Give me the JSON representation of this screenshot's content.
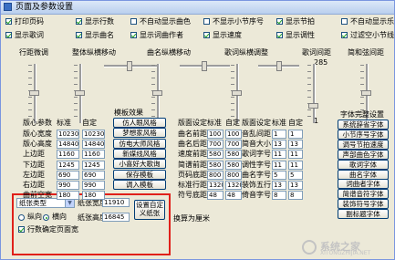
{
  "window": {
    "title": "页面及参数设置"
  },
  "checkboxes": [
    {
      "label": "打印页码",
      "checked": true
    },
    {
      "label": "显示行数",
      "checked": true
    },
    {
      "label": "不自动显示曲色",
      "checked": false
    },
    {
      "label": "不显示小节序号",
      "checked": false
    },
    {
      "label": "显示节拍",
      "checked": true
    },
    {
      "label": "不自动显示乐",
      "checked": false
    },
    {
      "label": "显示歌词",
      "checked": true
    },
    {
      "label": "显示曲名",
      "checked": true
    },
    {
      "label": "显示词曲作者",
      "checked": true
    },
    {
      "label": "显示速度",
      "checked": true
    },
    {
      "label": "显示调性",
      "checked": true
    },
    {
      "label": "过滤空小节线",
      "checked": true
    }
  ],
  "sliders": {
    "line_spacing": {
      "label": "行距微调"
    },
    "global_vertical": {
      "label": "整体纵横移动"
    },
    "title_vertical": {
      "label": "曲名纵横移动"
    },
    "lyrics_vertical": {
      "label": "歌词纵横调整"
    },
    "lyrics_spacing": {
      "label": "歌词间距",
      "value": "285",
      "min": "1"
    },
    "simple_spacing": {
      "label": "简和弦间距"
    }
  },
  "margins": {
    "headers": [
      "版心参数",
      "标准",
      "自定"
    ],
    "rows": [
      {
        "label": "版心宽度",
        "std": "10230",
        "custom": "10230"
      },
      {
        "label": "版心高度",
        "std": "14840",
        "custom": "14840"
      },
      {
        "label": "上边距",
        "std": "1160",
        "custom": "1160"
      },
      {
        "label": "下边距",
        "std": "1245",
        "custom": "1245"
      },
      {
        "label": "左边距",
        "std": "690",
        "custom": "690"
      },
      {
        "label": "右边距",
        "std": "990",
        "custom": "990"
      },
      {
        "label": "曲前空宽",
        "std": "180",
        "custom": "180"
      }
    ]
  },
  "style_buttons": {
    "header": "模板效果",
    "items": [
      "仿人眼风格",
      "梦想家风格",
      "仿电大师风格",
      "新媒线风格",
      "小喜好大歌询",
      "保存模板",
      "调入模板"
    ]
  },
  "spacing": {
    "headers": [
      "版面设定",
      "标准",
      "自定"
    ],
    "rows": [
      {
        "label": "曲名前距",
        "std": "100",
        "custom": "100"
      },
      {
        "label": "曲名后距",
        "std": "700",
        "custom": "700"
      },
      {
        "label": "速度前距",
        "std": "580",
        "custom": "580"
      },
      {
        "label": "简谱前距",
        "std": "580",
        "custom": "580"
      },
      {
        "label": "页码底距",
        "std": "800",
        "custom": "800"
      },
      {
        "label": "标准行距",
        "std": "1320",
        "custom": "1320"
      },
      {
        "label": "符号底距",
        "std": "48",
        "custom": "48"
      }
    ]
  },
  "fonts": {
    "headers": [
      "版面设定",
      "标准",
      "自定"
    ],
    "rows": [
      {
        "label": "音乱间距",
        "std": "1",
        "custom": "1"
      },
      {
        "label": "简音大小",
        "std": "13",
        "custom": "13"
      },
      {
        "label": "歌词字号",
        "std": "11",
        "custom": "11"
      },
      {
        "label": "调性字号",
        "std": "11",
        "custom": "11"
      },
      {
        "label": "曲名字号",
        "std": "5",
        "custom": "5"
      },
      {
        "label": "装饰五行",
        "std": "13",
        "custom": "13"
      },
      {
        "label": "倚音字号",
        "std": "8",
        "custom": "8"
      }
    ]
  },
  "font_settings": {
    "header": "字体完整设置",
    "items": [
      "系统辞省字体",
      "小节序号字体",
      "调号节拍速度",
      "声部曲色字体",
      "歌词字体",
      "曲名字体",
      "词曲者字体",
      "简谱音符字体",
      "装饰符号字体",
      "副标题字体"
    ]
  },
  "paper": {
    "type": "纸张类型",
    "width_label": "纸张宽度",
    "width_value": "11910",
    "height_label": "纸张高度",
    "height_value": "16845",
    "portrait_label": "纵向",
    "landscape_label": "横向",
    "page_break_label": "行数确定页面宽",
    "page_break_checked": true,
    "set_custom_button": "设置自定义纸张",
    "unit_note": "换算为厘米"
  },
  "watermark": {
    "text": "系统之家",
    "sub": "XITONGZHIJIA.NET"
  }
}
